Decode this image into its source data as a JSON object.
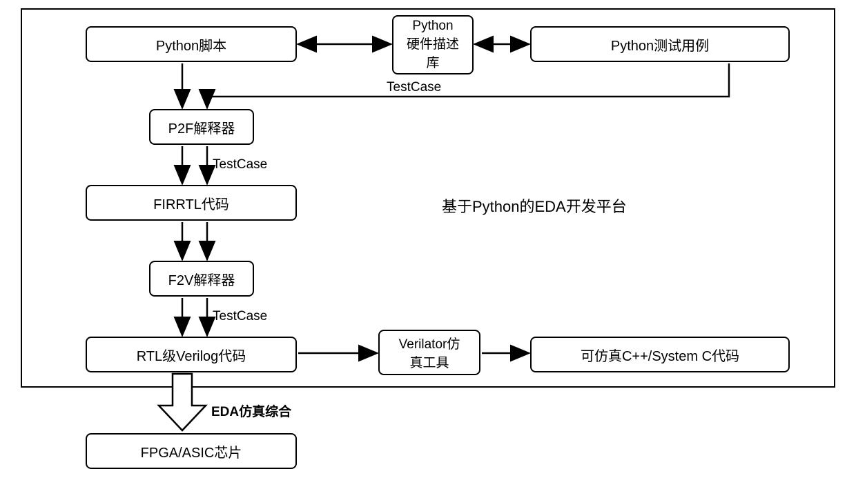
{
  "nodes": {
    "python_script": "Python脚本",
    "hw_lib": "Python\n硬件描述\n库",
    "test_cases": "Python测试用例",
    "p2f": "P2F解释器",
    "firrtl": "FIRRTL代码",
    "f2v": "F2V解释器",
    "rtl_verilog": "RTL级Verilog代码",
    "verilator": "Verilator仿\n真工具",
    "cpp_code": "可仿真C++/System C代码",
    "fpga": "FPGA/ASIC芯片"
  },
  "labels": {
    "platform_title": "基于Python的EDA开发平台",
    "tc1": "TestCase",
    "tc2": "TestCase",
    "tc3": "TestCase",
    "eda": "EDA仿真综合"
  }
}
